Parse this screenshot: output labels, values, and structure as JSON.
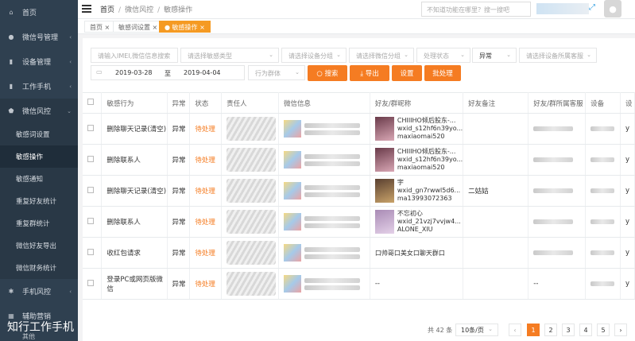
{
  "sidebar": {
    "items": [
      {
        "label": "首页",
        "icon": "home-icon",
        "glyph": "⌂"
      },
      {
        "label": "微信号管理",
        "icon": "chat-icon",
        "glyph": "●"
      },
      {
        "label": "设备管理",
        "icon": "phone-icon",
        "glyph": "▮"
      },
      {
        "label": "工作手机",
        "icon": "phone-icon",
        "glyph": "▮"
      },
      {
        "label": "微信风控",
        "icon": "shield-icon",
        "glyph": "⬟"
      }
    ],
    "sub_items": [
      "敏感词设置",
      "敏感操作",
      "敏感通知",
      "重复好友统计",
      "重复群统计",
      "微信好友导出",
      "微信财务统计"
    ],
    "bottom_items": [
      {
        "label": "手机风控",
        "icon": "gear-icon",
        "glyph": "✱"
      },
      {
        "label": "辅助营销",
        "icon": "chart-icon",
        "glyph": "▦"
      }
    ],
    "brand": "知行工作手机",
    "brand_sub": "其他"
  },
  "header": {
    "breadcrumb": [
      "首页",
      "微信风控",
      "敏感操作"
    ],
    "search_placeholder": "不知道功能在哪里？搜一搜吧"
  },
  "tabs": [
    {
      "label": "首页"
    },
    {
      "label": "敏感词设置"
    },
    {
      "label": "敏感操作"
    }
  ],
  "filters": {
    "imei_placeholder": "请输入IMEI,微信信息搜索",
    "type_placeholder": "请选择敏感类型",
    "device_group": "请选择设备分组",
    "wechat_group": "请选择微信分组",
    "status": "处理状态",
    "abnormal": "异常",
    "cs_placeholder": "请选择设备所属客服",
    "date_from": "2019-03-28",
    "date_to_label": "至",
    "date_to": "2019-04-04",
    "behavior_group": "行为群体",
    "btn_search": "搜索",
    "btn_export": "导出",
    "btn_settings": "设置",
    "btn_batch": "批处理"
  },
  "table": {
    "headers": [
      "敏感行为",
      "异常",
      "状态",
      "责任人",
      "微信信息",
      "好友/群昵称",
      "好友备注",
      "好友/群所属客服",
      "设备",
      "设"
    ],
    "rows": [
      {
        "behavior": "删除聊天记录(清空)",
        "abnormal": "异常",
        "status": "待处理",
        "friend": [
          "CHIIIHO倾后股东-...",
          "wxid_s12hf6n39yo...",
          "maxiaomai520"
        ],
        "remark": "",
        "cs": "",
        "dev": "y"
      },
      {
        "behavior": "删除联系人",
        "abnormal": "异常",
        "status": "待处理",
        "friend": [
          "CHIIIHO倾后股东-...",
          "wxid_s12hf6n39yo...",
          "maxiaomai520"
        ],
        "remark": "",
        "cs": "",
        "dev": "y"
      },
      {
        "behavior": "删除聊天记录(清空)",
        "abnormal": "异常",
        "status": "待处理",
        "friend": [
          "宇",
          "wxid_gn7rwwl5d6...",
          "ma13993072363"
        ],
        "remark": "二姑姑",
        "cs": "",
        "dev": "y"
      },
      {
        "behavior": "删除联系人",
        "abnormal": "异常",
        "status": "待处理",
        "friend": [
          "不忘初心",
          "wxid_21vzj7vvjw4...",
          "ALONE_XIU"
        ],
        "remark": "",
        "cs": "",
        "dev": "y"
      },
      {
        "behavior": "收红包请求",
        "abnormal": "异常",
        "status": "待处理",
        "friend": [
          "口帅哥口美女口聊天群口",
          "",
          ""
        ],
        "remark": "",
        "cs": "",
        "dev": "y"
      },
      {
        "behavior": "登录PC或网页版微信",
        "abnormal": "异常",
        "status": "待处理",
        "friend": [
          "--",
          "",
          ""
        ],
        "remark": "",
        "cs": "--",
        "dev": "y"
      }
    ]
  },
  "pager": {
    "total": "共 42 条",
    "size": "10条/页",
    "pages": [
      "1",
      "2",
      "3",
      "4",
      "5"
    ],
    "prev": "‹",
    "next": "›"
  }
}
